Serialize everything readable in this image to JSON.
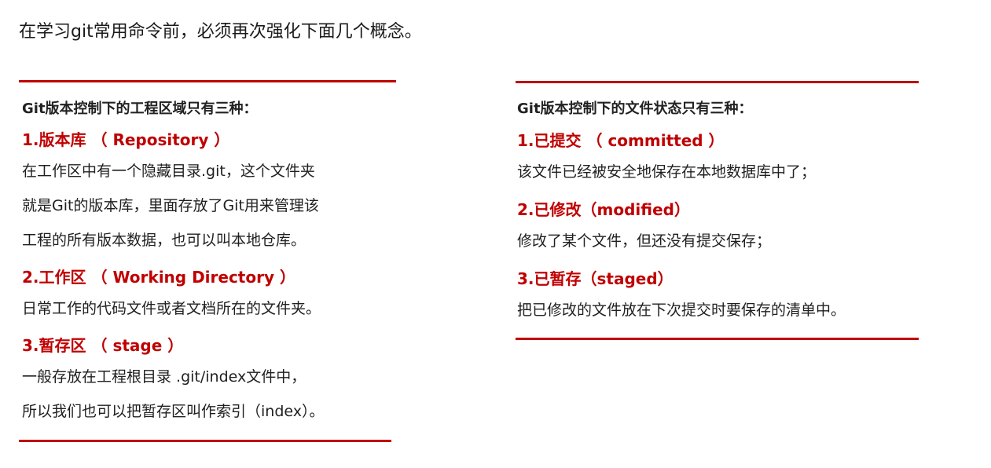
{
  "intro": "在学习git常用命令前，必须再次强化下面几个概念。",
  "left": {
    "heading": "Git版本控制下的工程区域只有三种：",
    "items": [
      {
        "title": "1.版本库 （ Repository ）",
        "lines": [
          "在工作区中有一个隐藏目录.git，这个文件夹",
          "就是Git的版本库，里面存放了Git用来管理该",
          "工程的所有版本数据，也可以叫本地仓库。"
        ]
      },
      {
        "title": "2.工作区 （ Working Directory ）",
        "lines": [
          "日常工作的代码文件或者文档所在的文件夹。"
        ]
      },
      {
        "title": "3.暂存区 （ stage ）",
        "lines": [
          "一般存放在工程根目录 .git/index文件中，",
          "所以我们也可以把暂存区叫作索引（index）。"
        ]
      }
    ]
  },
  "right": {
    "heading": "Git版本控制下的文件状态只有三种：",
    "items": [
      {
        "title": "1.已提交 （ committed ）",
        "lines": [
          "该文件已经被安全地保存在本地数据库中了；"
        ]
      },
      {
        "title": "2.已修改（modified）",
        "lines": [
          "修改了某个文件，但还没有提交保存；"
        ]
      },
      {
        "title": "3.已暂存（staged）",
        "lines": [
          "把已修改的文件放在下次提交时要保存的清单中。"
        ]
      }
    ]
  },
  "colors": {
    "accent": "#c00000",
    "text": "#1f1f1f"
  }
}
